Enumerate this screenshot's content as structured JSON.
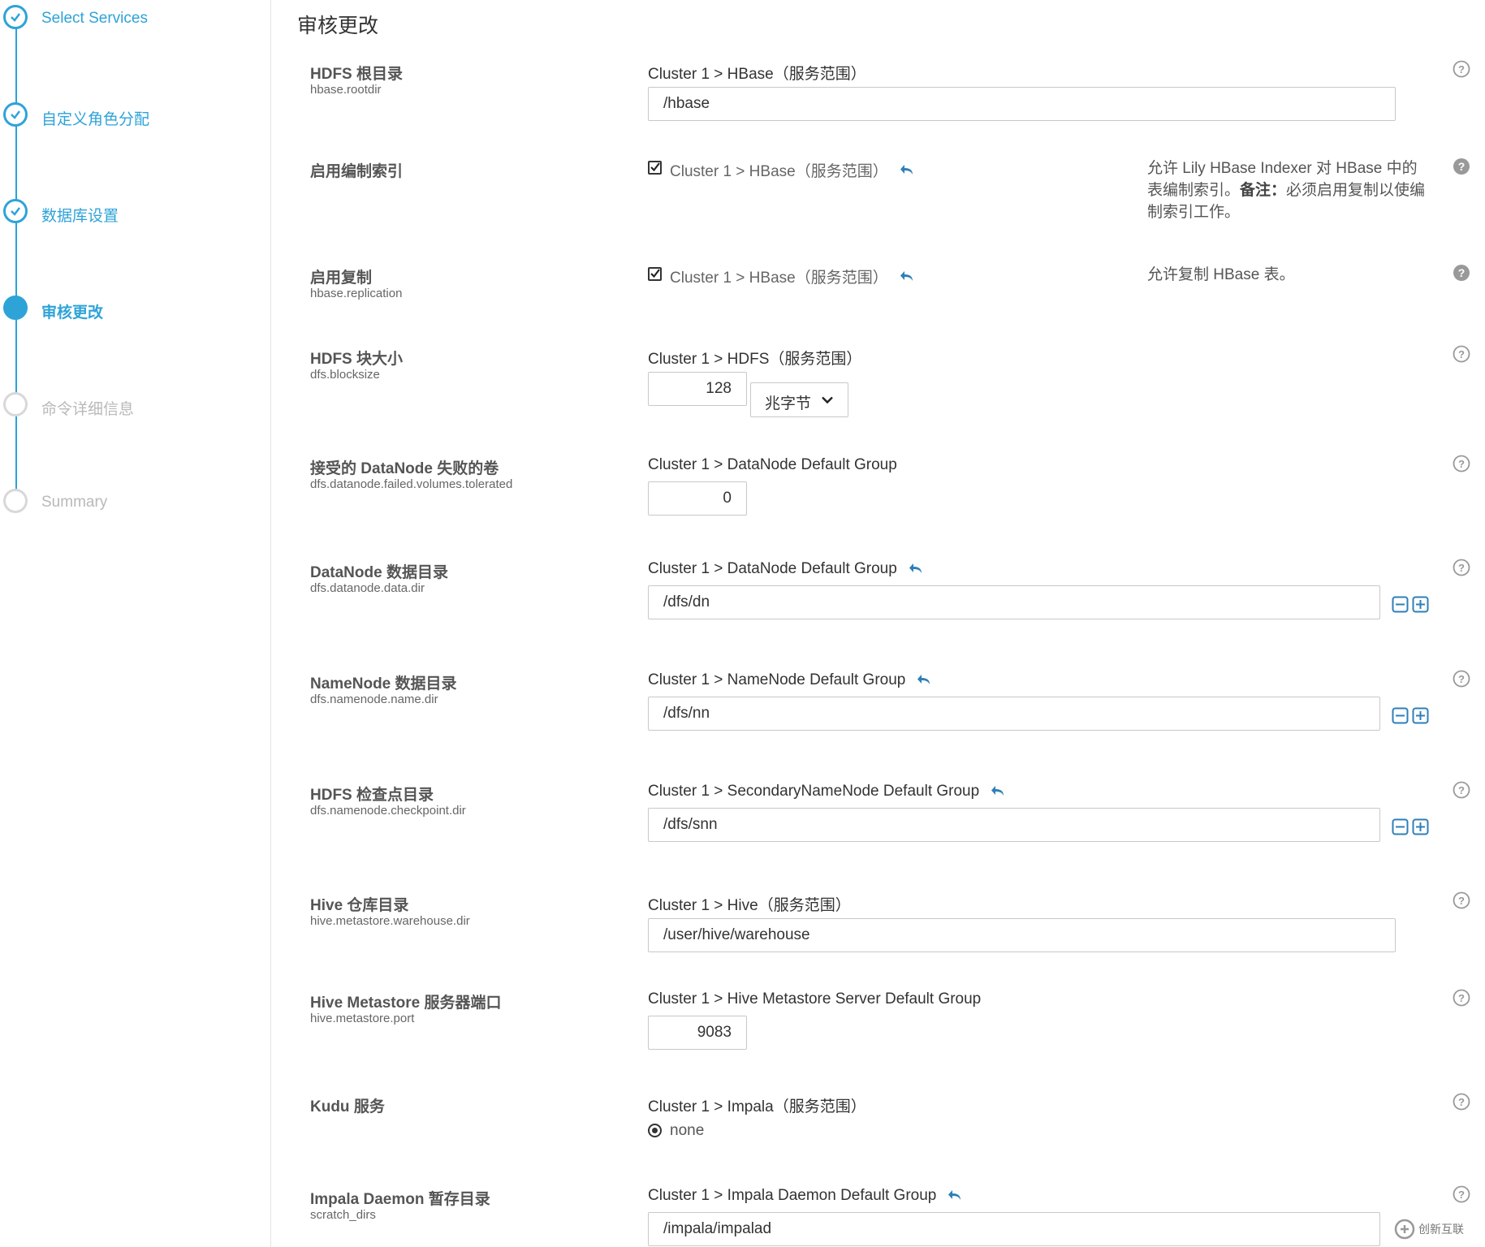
{
  "colors": {
    "accent": "#2ea3d8",
    "muted": "#b9b9b9"
  },
  "steps": [
    {
      "label": "Select Services",
      "state": "done"
    },
    {
      "label": "自定义角色分配",
      "state": "done"
    },
    {
      "label": "数据库设置",
      "state": "done"
    },
    {
      "label": "审核更改",
      "state": "current"
    },
    {
      "label": "命令详细信息",
      "state": "todo"
    },
    {
      "label": "Summary",
      "state": "todo"
    }
  ],
  "page_title": "审核更改",
  "rows": [
    {
      "name": "HDFS 根目录",
      "key": "hbase.rootdir",
      "scope": "Cluster 1 > HBase（服务范围）",
      "value": "/hbase"
    },
    {
      "name": "启用编制索引",
      "scope": "Cluster 1 > HBase（服务范围）",
      "checked": true,
      "desc_part1": "允许 Lily HBase Indexer 对 HBase 中的表编制索引。",
      "desc_bold": "备注：",
      "desc_part2": "必须启用复制以使编制索引工作。"
    },
    {
      "name": "启用复制",
      "key": "hbase.replication",
      "scope": "Cluster 1 > HBase（服务范围）",
      "checked": true,
      "desc": "允许复制 HBase 表。"
    },
    {
      "name": "HDFS 块大小",
      "key": "dfs.blocksize",
      "scope": "Cluster 1 > HDFS（服务范围）",
      "value": "128",
      "unit": "兆字节"
    },
    {
      "name": "接受的 DataNode 失败的卷",
      "key": "dfs.datanode.failed.volumes.tolerated",
      "scope": "Cluster 1 > DataNode Default Group",
      "value": "0"
    },
    {
      "name": "DataNode 数据目录",
      "key": "dfs.datanode.data.dir",
      "scope": "Cluster 1 > DataNode Default Group",
      "value": "/dfs/dn"
    },
    {
      "name": "NameNode 数据目录",
      "key": "dfs.namenode.name.dir",
      "scope": "Cluster 1 > NameNode Default Group",
      "value": "/dfs/nn"
    },
    {
      "name": "HDFS 检查点目录",
      "key": "dfs.namenode.checkpoint.dir",
      "scope": "Cluster 1 > SecondaryNameNode Default Group",
      "value": "/dfs/snn"
    },
    {
      "name": "Hive 仓库目录",
      "key": "hive.metastore.warehouse.dir",
      "scope": "Cluster 1 > Hive（服务范围）",
      "value": "/user/hive/warehouse"
    },
    {
      "name": "Hive Metastore 服务器端口",
      "key": "hive.metastore.port",
      "scope": "Cluster 1 > Hive Metastore Server Default Group",
      "value": "9083"
    },
    {
      "name": "Kudu 服务",
      "scope": "Cluster 1 > Impala（服务范围）",
      "radio_label": "none"
    },
    {
      "name": "Impala Daemon 暂存目录",
      "key": "scratch_dirs",
      "scope": "Cluster 1 > Impala Daemon Default Group",
      "value": "/impala/impalad"
    }
  ],
  "watermark": {
    "text": "创新互联",
    "icon": "watermark-logo-icon"
  }
}
